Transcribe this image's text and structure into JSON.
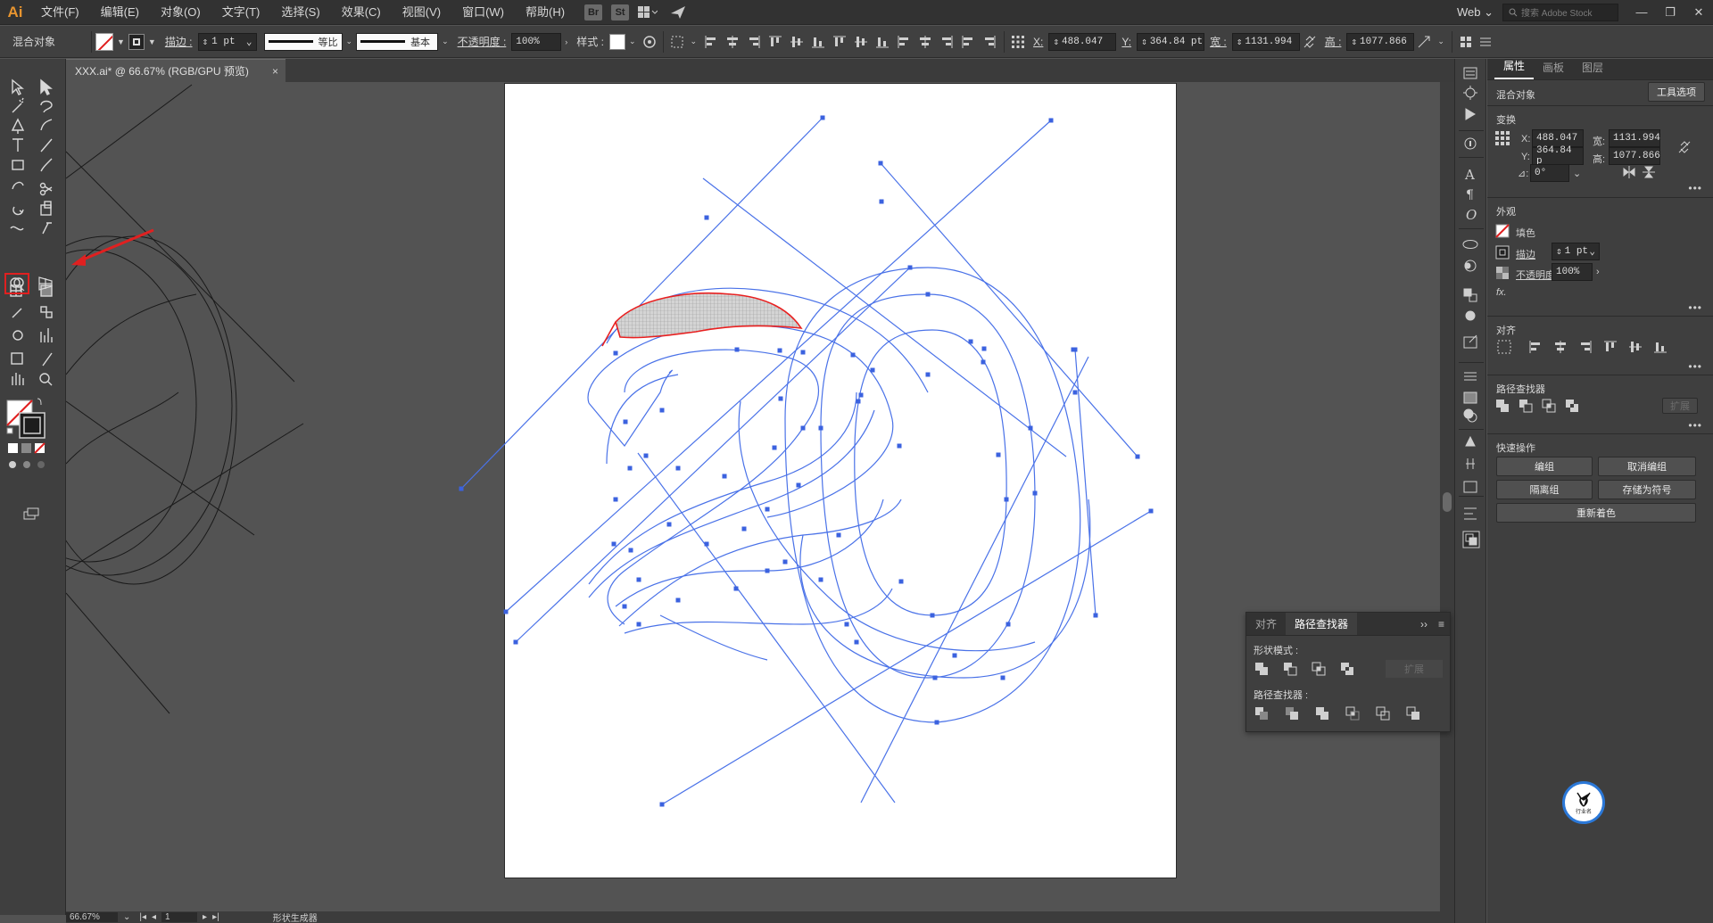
{
  "app": {
    "logo": "Ai",
    "menus": [
      "文件(F)",
      "编辑(E)",
      "对象(O)",
      "文字(T)",
      "选择(S)",
      "效果(C)",
      "视图(V)",
      "窗口(W)",
      "帮助(H)"
    ],
    "bridge": "Br",
    "stock": "St",
    "workspace": "Web",
    "stock_search_placeholder": "搜索 Adobe Stock"
  },
  "controlbar": {
    "object_type": "混合对象",
    "stroke_label": "描边 :",
    "stroke_weight": "1 pt",
    "stroke_profile": "等比",
    "brush": "基本",
    "opacity_label": "不透明度 :",
    "opacity": "100%",
    "style_label": "样式 :",
    "x_label": "X:",
    "x": "488.047",
    "y_label": "Y:",
    "y": "364.84 pt",
    "w_label": "宽 :",
    "w": "1131.994",
    "h_label": "高 :",
    "h": "1077.866"
  },
  "document": {
    "tab_title": "XXX.ai* @ 66.67% (RGB/GPU 预览)",
    "close": "×"
  },
  "statusbar": {
    "zoom": "66.67%",
    "artboard": "1",
    "tool": "形状生成器"
  },
  "properties": {
    "tabs": [
      "属性",
      "画板",
      "图层"
    ],
    "object_type": "混合对象",
    "tool_options": "工具选项",
    "transform_title": "变换",
    "x_label": "X:",
    "x": "488.047",
    "y_label": "Y:",
    "y": "364.84 p",
    "w_label": "宽:",
    "w": "1131.994",
    "h_label": "高:",
    "h": "1077.866",
    "angle": "0°",
    "appearance_title": "外观",
    "fill_label": "填色",
    "stroke_label": "描边",
    "stroke_weight": "1 pt",
    "opacity_label": "不透明度",
    "opacity": "100%",
    "fx": "fx.",
    "align_title": "对齐",
    "pathfinder_title": "路径查找器",
    "expand": "扩展",
    "quick_title": "快速操作",
    "btn_group": "编组",
    "btn_ungroup": "取消编组",
    "btn_isolate": "隔离组",
    "btn_symbol": "存储为符号",
    "btn_recolor": "重新着色"
  },
  "float_panel": {
    "tab_align": "对齐",
    "tab_pathfinder": "路径查找器",
    "shape_modes": "形状模式 :",
    "pathfinders": "路径查找器 :",
    "expand": "扩展"
  },
  "watermark": "行业名",
  "colors": {
    "path_blue": "#4a72e8",
    "selection_red": "#e82020",
    "accent_orange": "#e8952f"
  }
}
